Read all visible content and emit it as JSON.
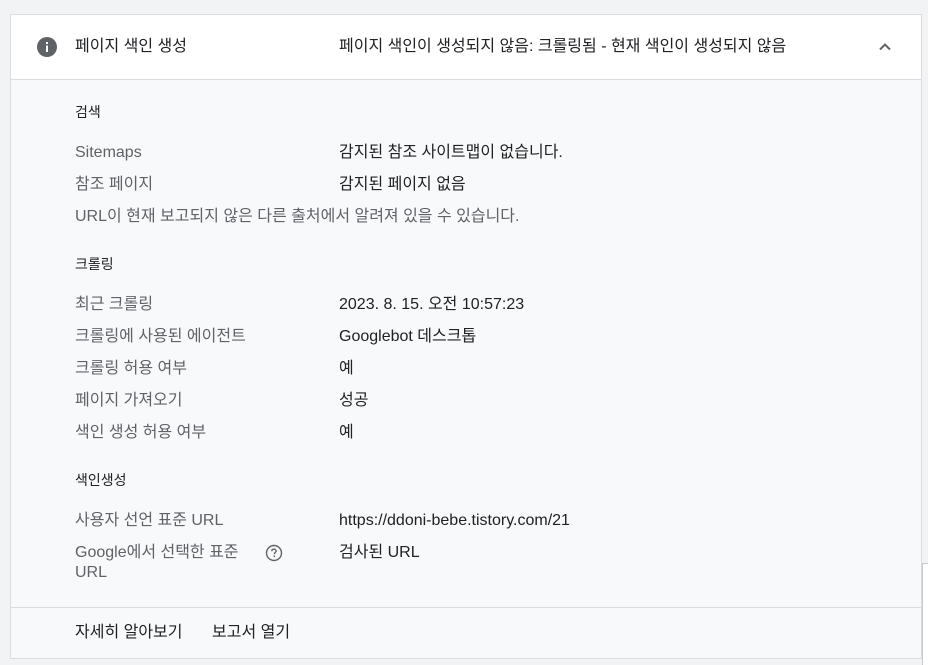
{
  "header": {
    "title": "페이지 색인 생성",
    "status": "페이지 색인이 생성되지 않음: 크롤링됨 - 현재 색인이 생성되지 않음",
    "info_icon": "info-icon",
    "collapse_icon": "chevron-up-icon"
  },
  "discovery": {
    "title": "검색",
    "rows": [
      {
        "label": "Sitemaps",
        "value": "감지된 참조 사이트맵이 없습니다."
      },
      {
        "label": "참조 페이지",
        "value": "감지된 페이지 없음"
      }
    ],
    "note": "URL이 현재 보고되지 않은 다른 출처에서 알려져 있을 수 있습니다."
  },
  "crawl": {
    "title": "크롤링",
    "rows": [
      {
        "label": "최근 크롤링",
        "value": "2023. 8. 15. 오전 10:57:23"
      },
      {
        "label": "크롤링에 사용된 에이전트",
        "value": "Googlebot 데스크톱"
      },
      {
        "label": "크롤링 허용 여부",
        "value": "예"
      },
      {
        "label": "페이지 가져오기",
        "value": "성공"
      },
      {
        "label": "색인 생성 허용 여부",
        "value": "예"
      }
    ]
  },
  "indexing": {
    "title": "색인생성",
    "rows": [
      {
        "label": "사용자 선언 표준 URL",
        "value": "https://ddoni-bebe.tistory.com/21"
      },
      {
        "label": "Google에서 선택한 표준 URL",
        "value": "검사된 URL"
      }
    ],
    "help_icon": "help-circle-icon"
  },
  "footer": {
    "learn_more": "자세히 알아보기",
    "open_report": "보고서 열기"
  },
  "colors": {
    "background": "#f8f9fa",
    "header_bg": "#ffffff",
    "border": "#dadce0",
    "label_text": "#5f6368",
    "value_text": "#202124",
    "info_icon": "#5f6368"
  }
}
